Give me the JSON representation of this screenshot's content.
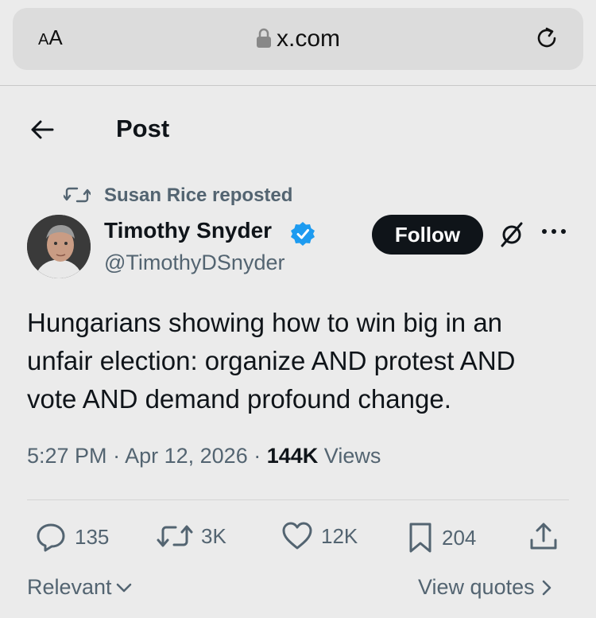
{
  "browser": {
    "text_size_label_big": "A",
    "text_size_label_small": "A",
    "url": "x.com",
    "lock_icon": "lock-icon",
    "reload_icon": "reload-icon"
  },
  "header": {
    "back_icon": "arrow-left-icon",
    "title": "Post"
  },
  "repost": {
    "icon": "repost-icon",
    "label": "Susan Rice reposted"
  },
  "author": {
    "name": "Timothy Snyder",
    "handle": "@TimothyDSnyder",
    "verified_icon": "verified-badge-icon",
    "follow_label": "Follow"
  },
  "tweet": {
    "text": "Hungarians showing how to win big in an unfair election: organize AND protest AND vote AND demand profound change.",
    "time": "5:27 PM",
    "date": "Apr 12, 2026",
    "views_count": "144K",
    "views_label": "Views"
  },
  "actions": {
    "replies": "135",
    "reposts": "3K",
    "likes": "12K",
    "bookmarks": "204"
  },
  "footer": {
    "sort_label": "Relevant",
    "view_quotes_label": "View quotes"
  },
  "colors": {
    "background": "#ebebeb",
    "text_primary": "#0f1419",
    "text_secondary": "#536471",
    "verified_blue": "#1d9bf0",
    "follow_bg": "#0f1419"
  }
}
